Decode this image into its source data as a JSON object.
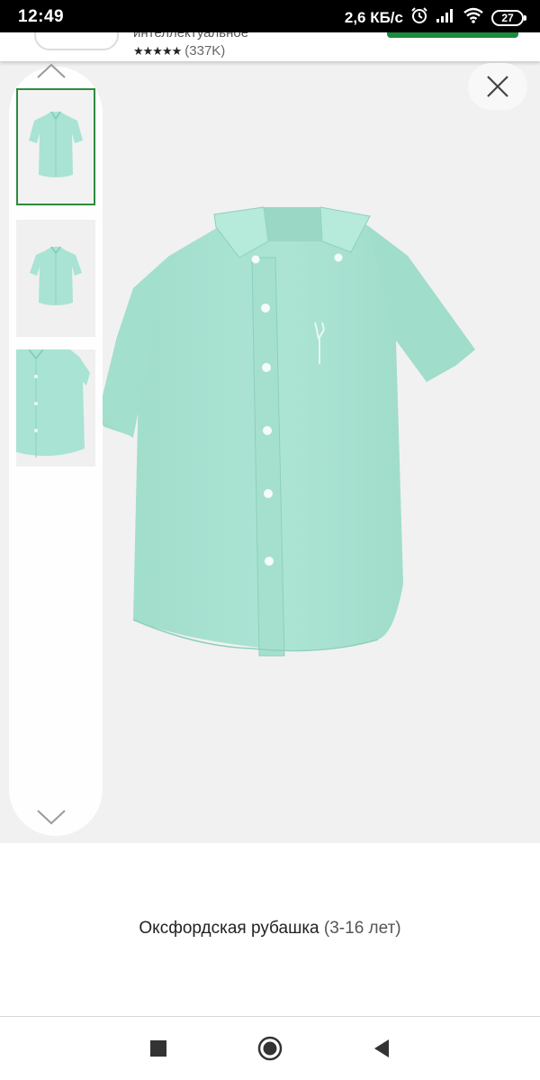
{
  "status_bar": {
    "time": "12:49",
    "network_speed": "2,6 КБ/с",
    "battery_level": "27",
    "icons": [
      "alarm-icon",
      "signal-icon",
      "wifi-icon",
      "battery-icon"
    ]
  },
  "app_header": {
    "app_name": "интеллектуальное",
    "rating_stars": "★★★★★",
    "rating_count": "(337K)"
  },
  "gallery": {
    "thumbnails": [
      {
        "name": "thumb-front",
        "selected": true
      },
      {
        "name": "thumb-front-small",
        "selected": false
      },
      {
        "name": "thumb-detail",
        "selected": false
      }
    ],
    "main_image": "mint-oxford-shirt",
    "colors": {
      "shirt": "#a9e3d3",
      "selected_border": "#2e8b3e",
      "background": "#f1f1f1"
    }
  },
  "product": {
    "title": "Оксфордская рубашка",
    "age_range": "(3-16 лет)"
  },
  "nav_bar": {
    "icons": [
      "recents-icon",
      "home-icon",
      "back-icon"
    ]
  }
}
